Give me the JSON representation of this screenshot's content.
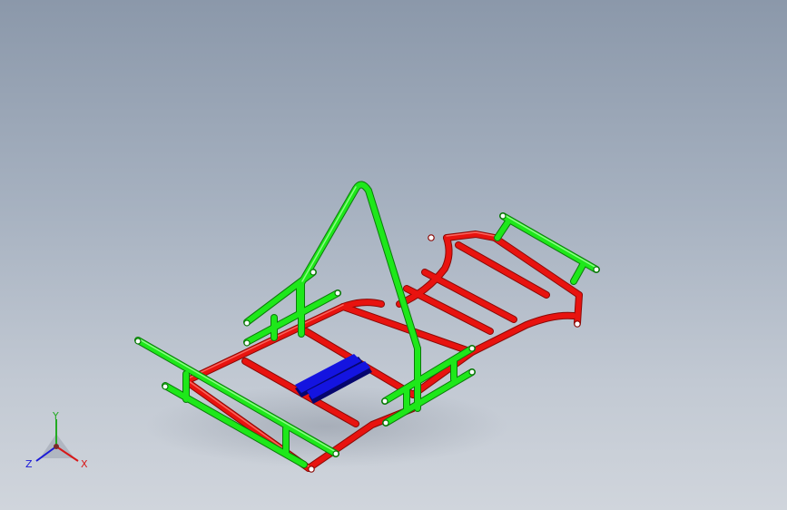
{
  "model": {
    "colors": {
      "frame": "#e8130f",
      "frame_dark": "#8a0906",
      "rails": "#1ee81a",
      "rails_dark": "#0b7a0a",
      "seat": "#1414e0",
      "seat_dark": "#06066e"
    }
  },
  "triad": {
    "x_label": "X",
    "y_label": "Y",
    "z_label": "Z",
    "x_color": "#d81818",
    "y_color": "#22aa22",
    "z_color": "#1a1ad8"
  }
}
